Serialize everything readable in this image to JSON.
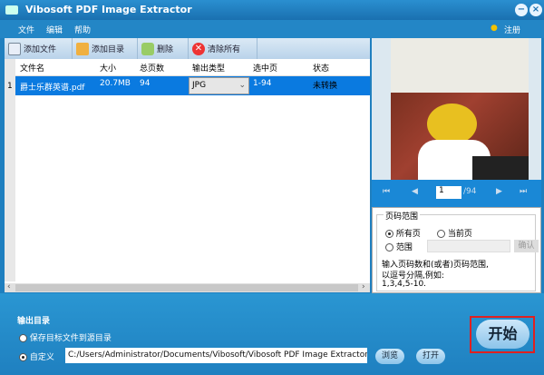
{
  "window": {
    "title": "Vibosoft PDF Image Extractor",
    "minimize": "−",
    "close": "×"
  },
  "menu": {
    "items": [
      "文件",
      "编辑",
      "帮助"
    ],
    "register": "注册"
  },
  "toolbar": {
    "add_file": "添加文件",
    "add_folder": "添加目录",
    "delete": "删除",
    "clear_all": "清除所有"
  },
  "table": {
    "headers": [
      "文件名",
      "大小",
      "总页数",
      "输出类型",
      "选中页",
      "状态"
    ],
    "rows": [
      {
        "index": "1",
        "filename": "爵士乐群英谱.pdf",
        "size": "20.7MB",
        "pages": "94",
        "type": "JPG",
        "selected": "1-94",
        "status": "未转换"
      }
    ]
  },
  "nav": {
    "current_page": "1",
    "total": "/94"
  },
  "page_range": {
    "legend": "页码范围",
    "all_pages": "所有页",
    "current_page": "当前页",
    "range": "范围",
    "confirm": "确认",
    "hint1": "输入页码数和(或者)页码范围,",
    "hint2": "以逗号分隔,例如:",
    "hint3": "1,3,4,5-10."
  },
  "output": {
    "title": "输出目录",
    "save_source": "保存目标文件到源目录",
    "custom": "自定义",
    "path": "C:/Users/Administrator/Documents/Vibosoft/Vibosoft PDF Image Extractor",
    "browse": "浏览",
    "open": "打开",
    "start": "开始"
  }
}
